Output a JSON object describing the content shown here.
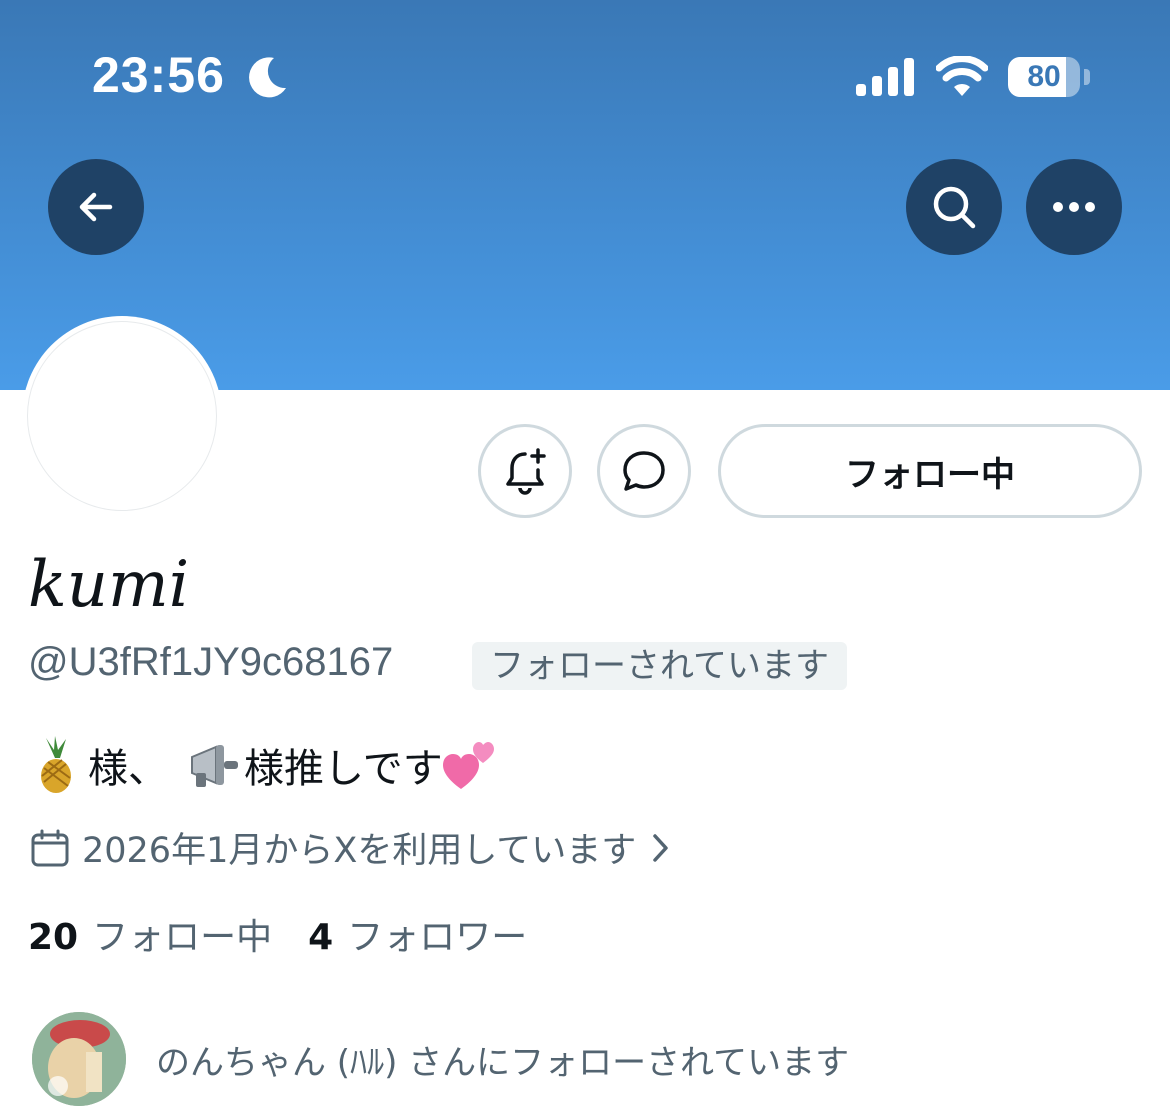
{
  "status_bar": {
    "time": "23:56",
    "battery_level": "80",
    "battery_fraction": 0.8
  },
  "nav": {
    "back_icon": "arrow-left-icon",
    "search_icon": "search-icon",
    "more_icon": "more-horizontal-icon"
  },
  "colors": {
    "banner_top": "#3a78b6",
    "banner_bottom": "#4a9ce8",
    "nav_button": "#1f4266",
    "secondary_text": "#536471"
  },
  "actions": {
    "notify_icon": "bell-plus-icon",
    "message_icon": "chat-bubble-icon",
    "follow_label": "フォロー中"
  },
  "profile": {
    "display_name": "kumi",
    "handle": "@U3fRf1JY9c68167",
    "follows_you": "フォローされています",
    "bio": {
      "emoji_1": "pineapple-emoji",
      "part_1": "様、",
      "emoji_2": "megaphone-emoji",
      "part_2": "様推しです",
      "emoji_3": "two-hearts-emoji"
    },
    "joined": "2026年1月からXを利用しています",
    "following_count": "20",
    "following_label": "フォロー中",
    "followers_count": "4",
    "followers_label": "フォロワー"
  },
  "followed_by": {
    "text": "のんちゃん (ﾊﾙ) さんにフォローされています"
  }
}
